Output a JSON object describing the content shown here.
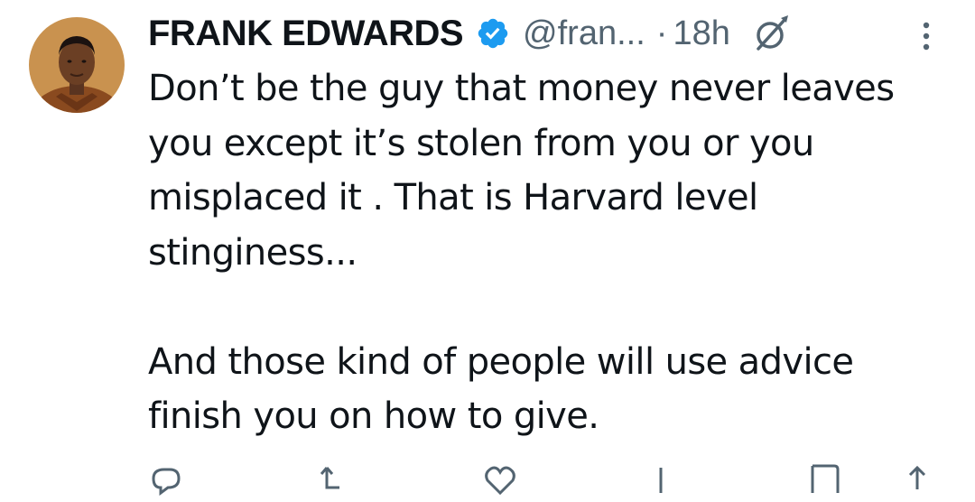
{
  "tweet": {
    "author_name": "FRANK EDWARDS",
    "handle": "@fran...",
    "separator": "·",
    "timestamp": "18h",
    "text": "Don’t be the guy that money never leaves\nyou except it’s stolen from you or you\nmisplaced it . That is Harvard level\nstinginess...\n\nAnd those kind of people will use advice\nfinish you on how to give."
  },
  "icons": {
    "verified": "verified-badge-icon",
    "edited": "edited-indicator-icon",
    "more": "more-options-icon",
    "reply": "reply-icon",
    "repost": "repost-icon",
    "like": "like-icon",
    "views": "views-icon",
    "bookmark": "bookmark-icon",
    "share": "share-icon"
  },
  "colors": {
    "text": "#0f1419",
    "secondary": "#536471",
    "verified_blue": "#1d9bf0",
    "background": "#ffffff"
  }
}
